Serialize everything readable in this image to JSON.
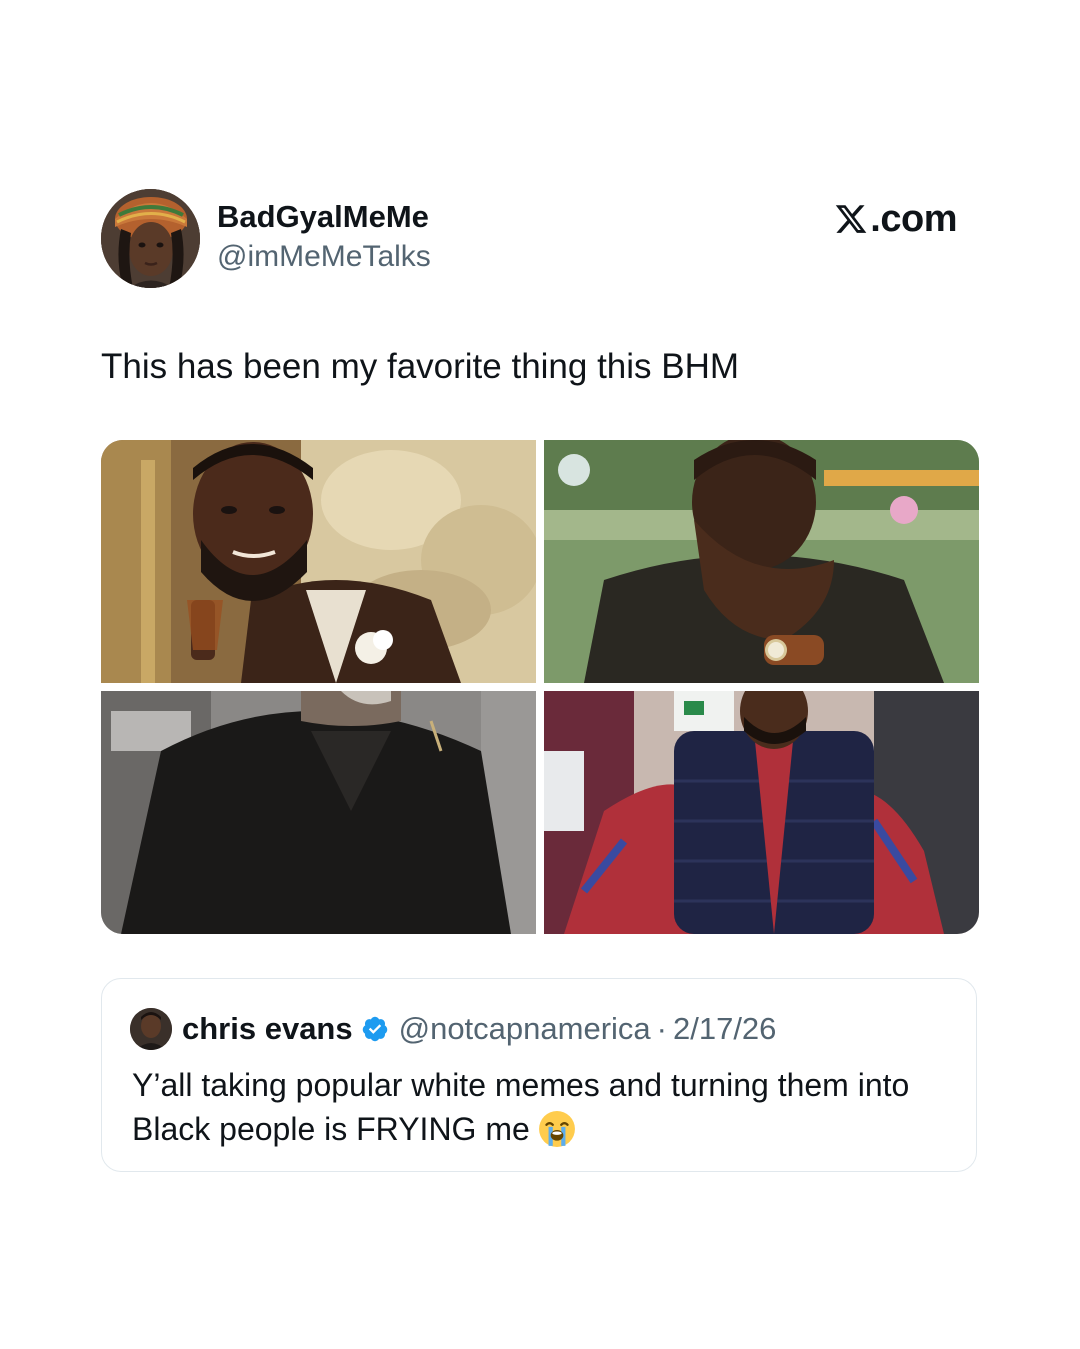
{
  "post": {
    "author": {
      "display_name": "BadGyalMeMe",
      "handle": "@imMeMeTalks",
      "avatar_icon": "profile-photo-avatar"
    },
    "site": {
      "logo_icon": "x-logo-icon",
      "suffix": ".com"
    },
    "text": "This has been my favorite thing this BHM",
    "media": [
      {
        "name": "meme-image-laughing-man-with-glass"
      },
      {
        "name": "meme-image-man-covering-mouth-laughing"
      },
      {
        "name": "meme-image-man-in-black-shirt"
      },
      {
        "name": "meme-image-man-in-vest-hands-on-hips"
      }
    ]
  },
  "quoted_post": {
    "display_name": "chris evans",
    "verified_icon": "verified-badge-icon",
    "verified_color": "#1d9bf0",
    "handle": "@notcapnamerica",
    "separator": "·",
    "date": "2/17/26",
    "text": "Y’all taking popular white memes and turning them into Black people is FRYING me",
    "emoji_icon": "loudly-crying-face-emoji"
  },
  "colors": {
    "text_primary": "#0f1419",
    "text_secondary": "#536471",
    "card_border": "#e1e8ed",
    "background": "#ffffff"
  }
}
